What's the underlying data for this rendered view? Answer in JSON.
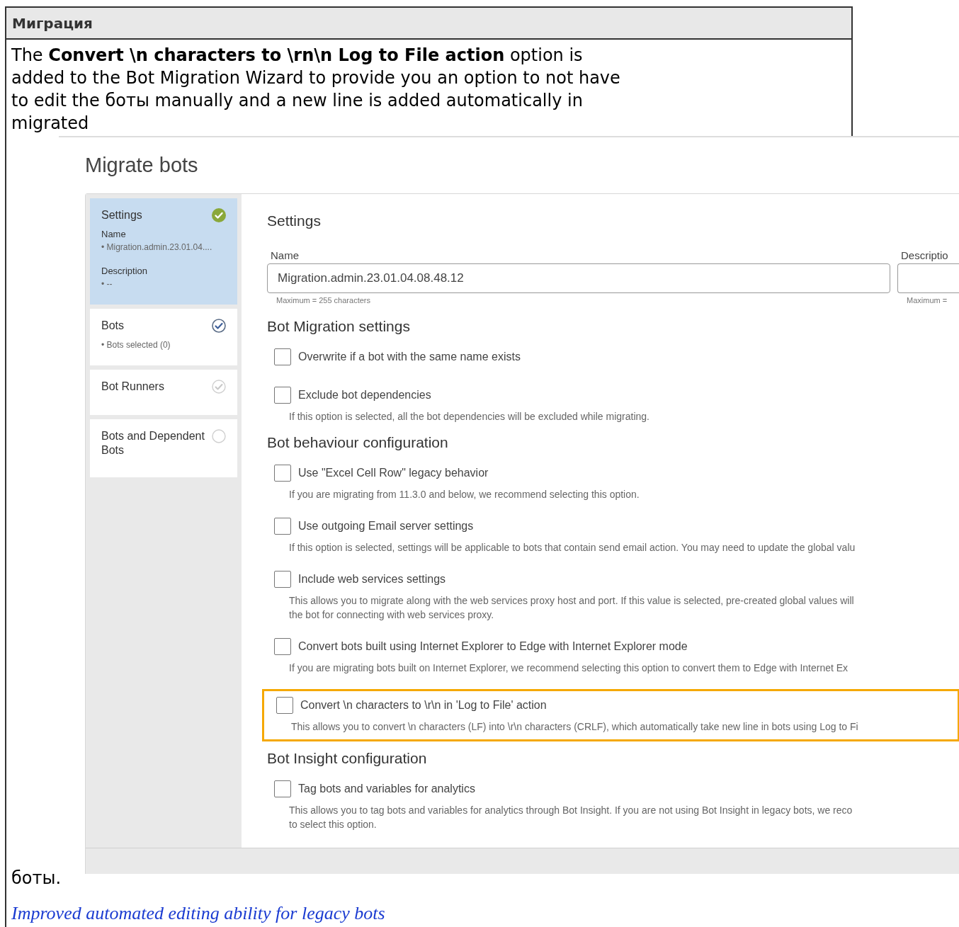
{
  "doc": {
    "section_title": "Миграция",
    "paragraph": "The **Convert \\n characters to \\rn\\n Log to File action** option is added to the Bot Migration Wizard to provide you an option to not have to edit the боты manually and a new line is added automatically in migrated",
    "paragraph_end": "боты.",
    "link": "Improved automated editing ability for legacy bots"
  },
  "screenshot": {
    "title": "Migrate bots",
    "steps": [
      {
        "title": "Settings",
        "kind": "complete",
        "selected": true,
        "details": [
          {
            "label": "Name",
            "value": "• Migration.admin.23.01.04...."
          },
          {
            "label": "Description",
            "value": "• --"
          }
        ]
      },
      {
        "title": "Bots",
        "kind": "done",
        "selected": false,
        "details": [
          {
            "value": "• Bots selected (0)"
          }
        ]
      },
      {
        "title": "Bot Runners",
        "kind": "inactive",
        "selected": false
      },
      {
        "title": "Bots and Dependent Bots",
        "kind": "pending",
        "selected": false
      }
    ],
    "form": {
      "heading": "Settings",
      "name_label": "Name",
      "name_value": "Migration.admin.23.01.04.08.48.12",
      "name_hint": "Maximum = 255 characters",
      "description_label": "Descriptio",
      "description_hint": "Maximum ="
    },
    "sections": [
      {
        "heading": "Bot Migration settings",
        "options": [
          {
            "label": "Overwrite if a bot with the same name exists",
            "checked": false,
            "highlighted": false
          },
          {
            "label": "Exclude bot dependencies",
            "checked": false,
            "highlighted": false,
            "help": [
              "If this option is selected, all the bot dependencies will be excluded while migrating."
            ]
          }
        ]
      },
      {
        "heading": "Bot behaviour configuration",
        "options": [
          {
            "label": "Use \"Excel Cell Row\" legacy behavior",
            "checked": false,
            "highlighted": false,
            "help": [
              "If you are migrating from 11.3.0 and below, we recommend selecting this option."
            ]
          },
          {
            "label": "Use outgoing Email server settings",
            "checked": false,
            "highlighted": false,
            "help": [
              "If this option is selected, settings will be applicable to bots that contain send email action. You may need to update the global valu"
            ]
          },
          {
            "label": "Include web services settings",
            "checked": false,
            "highlighted": false,
            "help": [
              "This allows you to migrate along with the web services proxy host and port. If this value is selected, pre-created global values will",
              "the bot for connecting with web services proxy."
            ]
          },
          {
            "label": "Convert bots built using Internet Explorer to Edge with Internet Explorer mode",
            "checked": false,
            "highlighted": false,
            "help": [
              "If you are migrating bots built on Internet Explorer, we recommend selecting this option to convert them to Edge with Internet Ex"
            ]
          },
          {
            "label": "Convert \\n characters to \\r\\n in 'Log to File' action",
            "checked": false,
            "highlighted": true,
            "help": [
              "This allows you to convert \\n characters (LF) into \\r\\n characters (CRLF), which automatically take new line in bots using Log to Fi"
            ]
          }
        ]
      },
      {
        "heading": "Bot Insight configuration",
        "options": [
          {
            "label": "Tag bots and variables for analytics",
            "checked": false,
            "highlighted": false,
            "help": [
              "This allows you to tag bots and variables for analytics through Bot Insight. If you are not using Bot Insight in legacy bots, we reco",
              "to select this option."
            ]
          }
        ]
      }
    ]
  }
}
